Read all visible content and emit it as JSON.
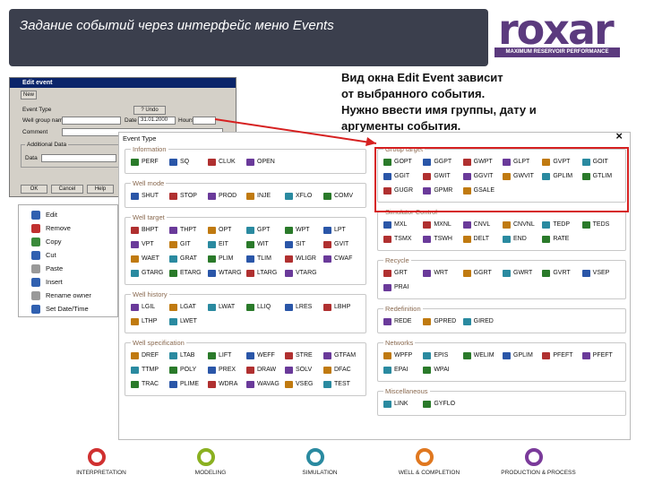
{
  "slide_title": "Задание событий через интерфейс меню Events",
  "logo": {
    "word": "roxar",
    "tagline": "MAXIMUM RESERVOIR PERFORMANCE"
  },
  "description": [
    "Вид окна Edit Event зависит",
    "от выбранного события.",
    "Нужно ввести имя группы, дату и",
    "аргументы события."
  ],
  "edit_dialog": {
    "title": "Edit event",
    "tab": "New",
    "event_type_label": "Event Type",
    "event_type_btn": "? Undo",
    "group_label": "Well group name",
    "date_label": "Date",
    "date_value": "31.01.2000",
    "hours_label": "Hours",
    "comment_label": "Comment",
    "additional_label": "Additional Data",
    "data_label": "Data",
    "ok": "OK",
    "cancel": "Cancel",
    "help": "Help"
  },
  "context_menu": [
    {
      "label": "Edit",
      "color": "#3060b0"
    },
    {
      "label": "Remove",
      "color": "#c03030"
    },
    {
      "label": "Copy",
      "color": "#3a8a3a"
    },
    {
      "label": "Cut",
      "color": "#3060b0"
    },
    {
      "label": "Paste",
      "color": "#999999"
    },
    {
      "label": "Insert",
      "color": "#3060b0"
    },
    {
      "label": "Rename owner",
      "color": "#999999"
    },
    {
      "label": "Set Date/Time",
      "color": "#3060b0"
    }
  ],
  "event_window": {
    "title": "Event Type",
    "close": "×",
    "left_groups": [
      {
        "label": "Information",
        "rows": [
          [
            "PERF",
            "SQ",
            "CLUK",
            "OPEN"
          ]
        ]
      },
      {
        "label": "Well mode",
        "rows": [
          [
            "SHUT",
            "STOP",
            "PROD",
            "INJE",
            "XFLO",
            "COMV"
          ]
        ]
      },
      {
        "label": "Well target",
        "rows": [
          [
            "BHPT",
            "THPT",
            "OPT",
            "GPT",
            "WPT",
            "LPT"
          ],
          [
            "VPT",
            "GIT",
            "EIT",
            "WIT",
            "SIT",
            "GVIT"
          ],
          [
            "WAET",
            "GRAT",
            "PLIM",
            "TLIM",
            "WLIGR",
            "CWAF"
          ],
          [
            "GTARG",
            "ETARG",
            "WTARG",
            "LTARG",
            "VTARG"
          ]
        ]
      },
      {
        "label": "Well history",
        "rows": [
          [
            "LGIL",
            "LGAT",
            "LWAT",
            "LLIQ",
            "LRES",
            "LBHP"
          ],
          [
            "LTHP",
            "LWET"
          ]
        ]
      },
      {
        "label": "Well specification",
        "rows": [
          [
            "DREF",
            "LTAB",
            "LIFT",
            "WEFF",
            "STRE",
            "GTFAM"
          ],
          [
            "TTMP",
            "POLY",
            "PREX",
            "DRAW",
            "SOLV",
            "DFAC"
          ],
          [
            "TRAC",
            "PLIME",
            "WDRA",
            "WAVAG",
            "VSEG",
            "TEST"
          ]
        ]
      }
    ],
    "right_groups": [
      {
        "label": "Group target",
        "rows": [
          [
            "GOPT",
            "GGPT",
            "GWPT",
            "GLPT",
            "GVPT",
            "GOIT"
          ],
          [
            "GGIT",
            "GWIT",
            "GGVIT",
            "GWVIT",
            "GPLIM",
            "GTLIM"
          ],
          [
            "GUGR",
            "GPMR",
            "GSALE"
          ]
        ]
      },
      {
        "label": "Simulator Control",
        "rows": [
          [
            "MXL",
            "MXNL",
            "CNVL",
            "CNVNL",
            "TEDP",
            "TEDS"
          ],
          [
            "TSMX",
            "TSWH",
            "DELT",
            "END",
            "RATE"
          ]
        ]
      },
      {
        "label": "Recycle",
        "rows": [
          [
            "GRT",
            "WRT",
            "GGRT",
            "GWRT",
            "GVRT",
            "VSEP"
          ],
          [
            "PRAI"
          ]
        ]
      },
      {
        "label": "Redefinition",
        "rows": [
          [
            "REDE",
            "GPRED",
            "GIRED"
          ]
        ]
      },
      {
        "label": "Networks",
        "rows": [
          [
            "WPFP",
            "EPIS",
            "WELIM",
            "GPLIM",
            "PFEFT",
            "PFEFT"
          ],
          [
            "EPAI",
            "WPAI"
          ]
        ]
      },
      {
        "label": "Miscellaneous",
        "rows": [
          [
            "LINK",
            "GYFLO"
          ]
        ]
      }
    ]
  },
  "footer": [
    {
      "label": "INTERPRETATION",
      "color": "#d03030"
    },
    {
      "label": "MODELING",
      "color": "#8ab020"
    },
    {
      "label": "SIMULATION",
      "color": "#2a8aa0"
    },
    {
      "label": "WELL & COMPLETION",
      "color": "#e07820"
    },
    {
      "label": "PRODUCTION & PROCESS",
      "color": "#7a3a9a"
    }
  ]
}
